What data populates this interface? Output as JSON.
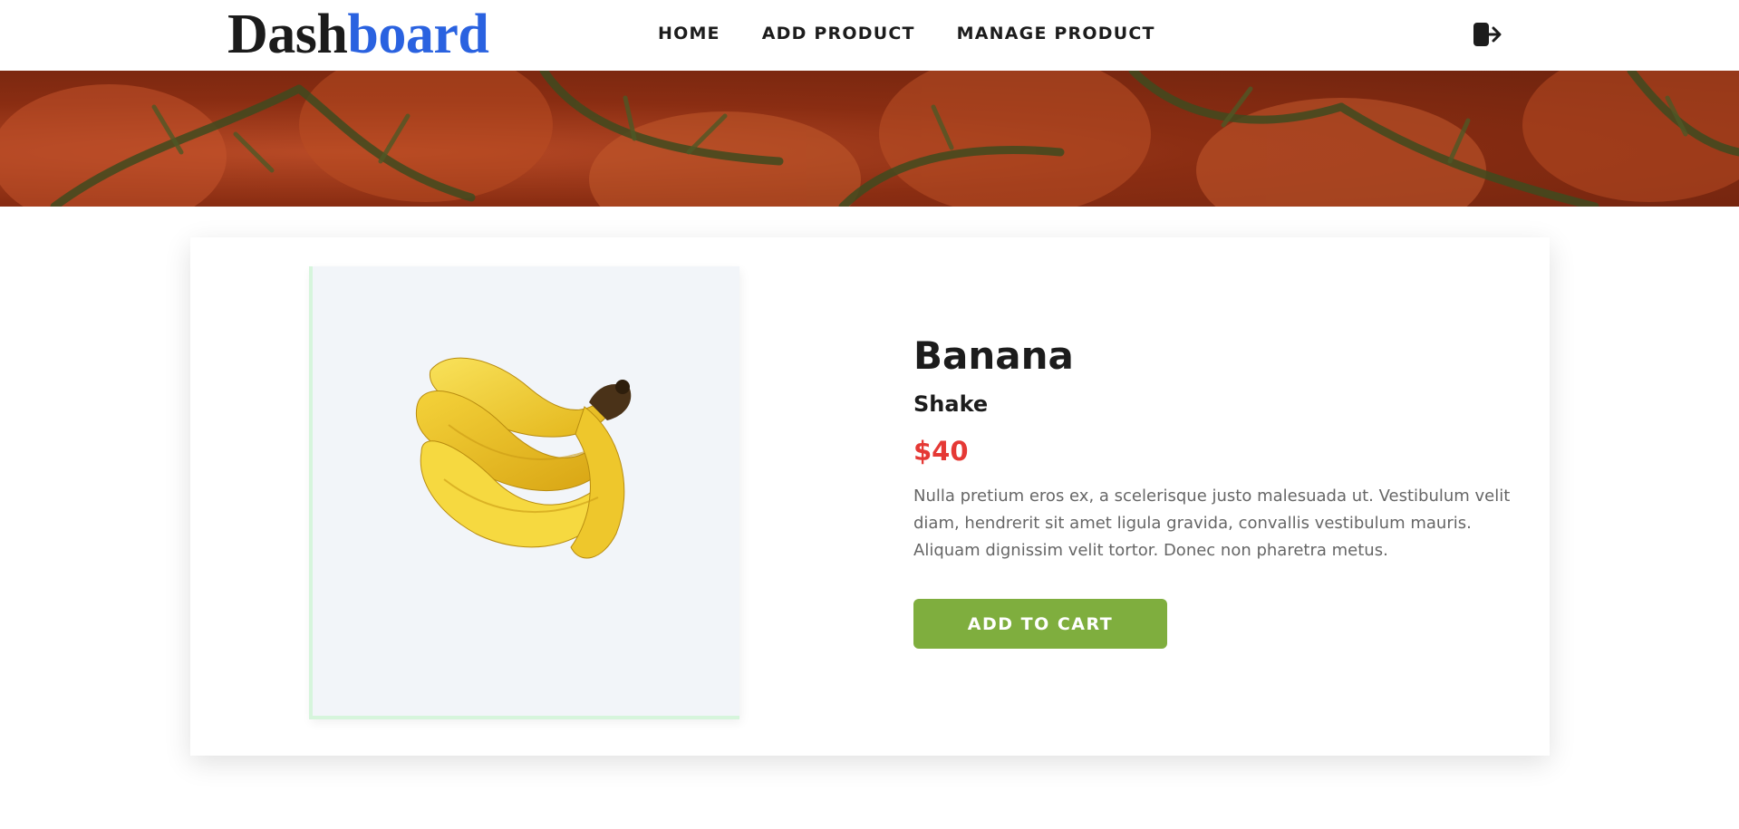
{
  "brand": {
    "part1": "Dash",
    "part2": "board",
    "accent_color": "#2a62e0"
  },
  "nav": {
    "home": "HOME",
    "add_product": "ADD PRODUCT",
    "manage_product": "MANAGE PRODUCT"
  },
  "header_icons": {
    "logout": "logout-icon"
  },
  "banner": {
    "image": "tomatoes-vine-background"
  },
  "product": {
    "image": "banana-bunch",
    "name": "Banana",
    "category": "Shake",
    "price": "$40",
    "description": "Nulla pretium eros ex, a scelerisque justo malesuada ut. Vestibulum velit diam, hendrerit sit amet ligula gravida, convallis vestibulum mauris. Aliquam dignissim velit tortor. Donec non pharetra metus.",
    "price_color": "#e53935",
    "add_to_cart_label": "ADD TO CART",
    "button_color": "#7fae3e"
  }
}
